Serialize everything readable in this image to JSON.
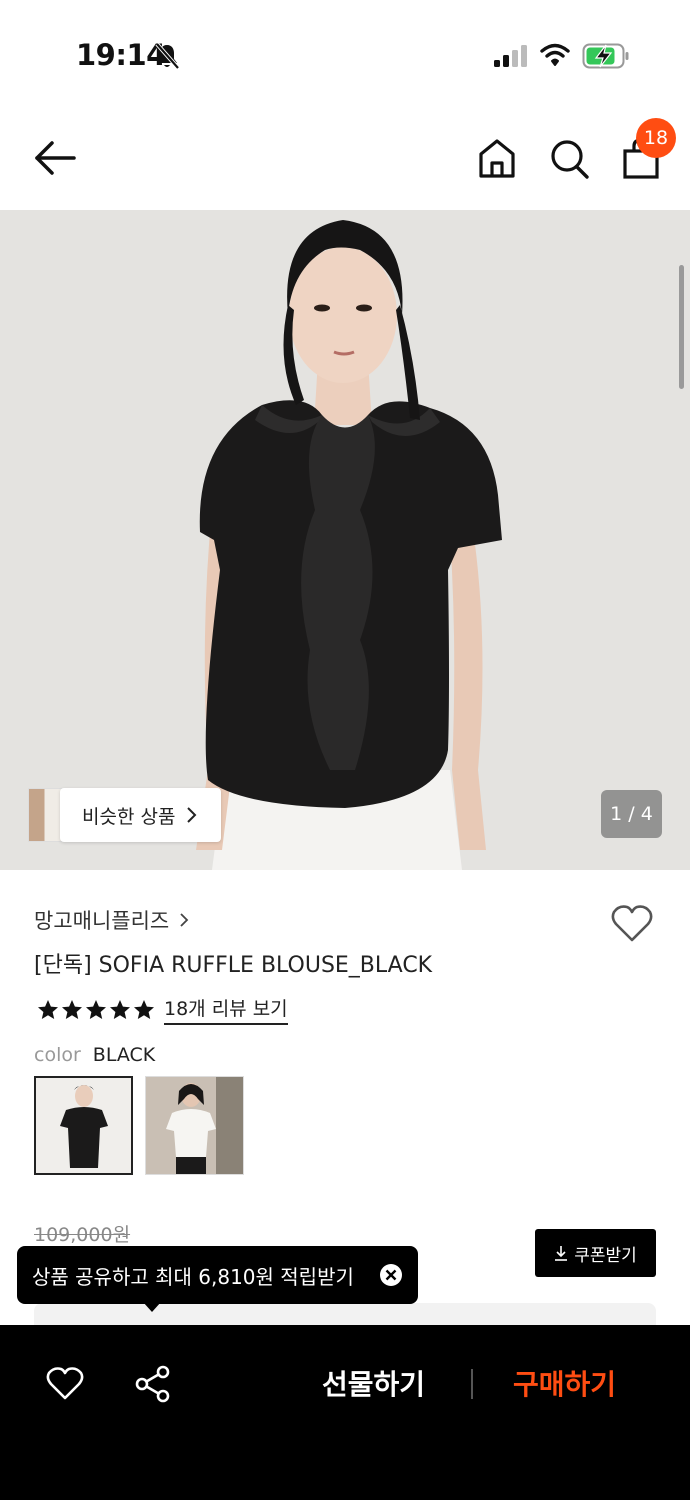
{
  "status_bar": {
    "time": "19:14",
    "icons": [
      "bell-off-icon",
      "cellular-signal-icon",
      "wifi-icon",
      "battery-charging-icon"
    ]
  },
  "nav": {
    "icons": [
      "back-arrow-icon",
      "home-icon",
      "search-icon",
      "shopping-bag-icon"
    ],
    "cart_count": "18",
    "badge_color": "#ff4d12"
  },
  "gallery": {
    "similar_label": "비슷한 상품",
    "page_counter": "1 / 4"
  },
  "product": {
    "brand": "망고매니플리즈",
    "title": "[단독] SOFIA RUFFLE BLOUSE_BLACK",
    "rating_stars": 5,
    "review_link": "18개 리뷰 보기",
    "color_label": "color",
    "color_value": "BLACK",
    "swatches": [
      "black-blouse-swatch",
      "white-blouse-swatch"
    ],
    "original_price": "109,000원"
  },
  "coupon": {
    "label": "쿠폰받기"
  },
  "tooltip": {
    "text": "상품 공유하고 최대 6,810원 적립받기"
  },
  "bottom_bar": {
    "gift_label": "선물하기",
    "buy_label": "구매하기",
    "accent_color": "#ff4d12"
  }
}
